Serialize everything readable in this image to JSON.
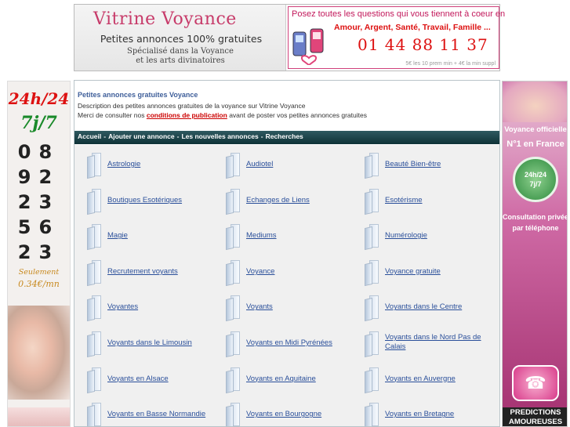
{
  "banner": {
    "logo_title": "Vitrine Voyance",
    "logo_subtitle": "Petites annonces 100% gratuites",
    "logo_tag1": "Spécialisé dans la Voyance",
    "logo_tag2": "et les arts divinatoires",
    "ad_line1": "Posez toutes les questions qui vous tiennent à coeur en",
    "ad_line2": "Amour, Argent, Santé, Travail, Famille ...",
    "ad_phone": "01 44 88 11 37",
    "ad_price": "5€ les 10 prem min + 4€ la min suppl"
  },
  "left_ad": {
    "hours": "24h/24",
    "days": "7j/7",
    "digits": [
      "08",
      "92",
      "23",
      "56",
      "23"
    ],
    "only": "Seulement",
    "price": "0.34€/mn"
  },
  "right_ad": {
    "line1": "Voyance officielle",
    "line2": "N°1 en France",
    "clock_line1": "24h/24",
    "clock_line2": "7j/7",
    "line3a": "Consultation privée",
    "line3b": "par téléphone",
    "pred1": "PREDICTIONS",
    "pred2": "AMOUREUSES"
  },
  "main": {
    "title": "Petites annonces gratuites Voyance",
    "description": "Description des petites annonces gratuites de la voyance sur Vitrine Voyance",
    "note_before": "Merci de consulter nos ",
    "note_link": "conditions de publication",
    "note_after": " avant de poster vos petites annonces gratuites"
  },
  "nav": {
    "items": [
      "Accueil",
      "Ajouter une annonce",
      "Les nouvelles annonces",
      "Recherches"
    ],
    "separator": "-"
  },
  "categories": [
    [
      "Astrologie",
      "Audiotel",
      "Beauté Bien-être"
    ],
    [
      "Boutiques Esotériques",
      "Echanges de Liens",
      "Esotérisme"
    ],
    [
      "Magie",
      "Mediums",
      "Numérologie"
    ],
    [
      "Recrutement voyants",
      "Voyance",
      "Voyance gratuite"
    ],
    [
      "Voyantes",
      "Voyants",
      "Voyants dans le Centre"
    ],
    [
      "Voyants dans le Limousin",
      "Voyants en Midi Pyrénées",
      "Voyants dans le Nord Pas de Calais"
    ],
    [
      "Voyants en Alsace",
      "Voyants en Aquitaine",
      "Voyants en Auvergne"
    ],
    [
      "Voyants en Basse Normandie",
      "Voyants en Bourgogne",
      "Voyants en Bretagne"
    ]
  ]
}
